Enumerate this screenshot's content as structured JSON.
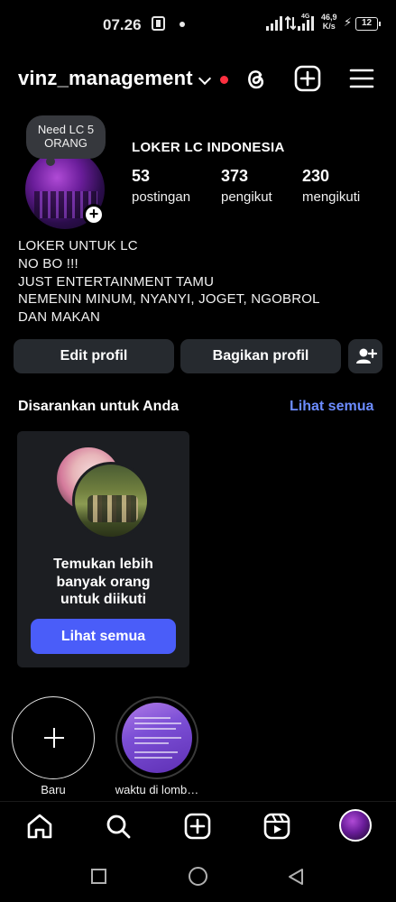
{
  "status_bar": {
    "time": "07.26",
    "network_type": "4G",
    "speed_value": "46,9",
    "speed_unit": "K/s",
    "battery": "12"
  },
  "header": {
    "username": "vinz_management",
    "icons": [
      "chevron-down-icon",
      "notification-dot",
      "threads-icon",
      "new-post-icon",
      "menu-icon"
    ]
  },
  "profile": {
    "note": "Need LC 5 ORANG",
    "display_name": "LOKER LC INDONESIA",
    "stats": [
      {
        "value": "53",
        "label": "postingan"
      },
      {
        "value": "373",
        "label": "pengikut"
      },
      {
        "value": "230",
        "label": "mengikuti"
      }
    ],
    "bio_lines": [
      "LOKER UNTUK LC",
      "NO BO !!!",
      "JUST ENTERTAINMENT TAMU",
      "NEMENIN MINUM, NYANYI, JOGET, NGOBROL",
      "DAN MAKAN"
    ]
  },
  "actions": {
    "edit_label": "Edit profil",
    "share_label": "Bagikan profil"
  },
  "suggestions": {
    "title": "Disarankan untuk Anda",
    "see_all": "Lihat semua",
    "card_text_lines": [
      "Temukan lebih",
      "banyak orang",
      "untuk diikuti"
    ],
    "card_button": "Lihat semua"
  },
  "highlights": [
    {
      "label": "Baru"
    },
    {
      "label": "waktu di lomb…"
    }
  ],
  "bottom_nav": [
    "home-icon",
    "search-icon",
    "create-icon",
    "reels-icon",
    "profile-avatar"
  ],
  "colors": {
    "background": "#000000",
    "button_bg": "#262a2f",
    "link_blue": "#6c8cff",
    "primary_button": "#4a5df9",
    "notification_red": "#ff3040"
  }
}
